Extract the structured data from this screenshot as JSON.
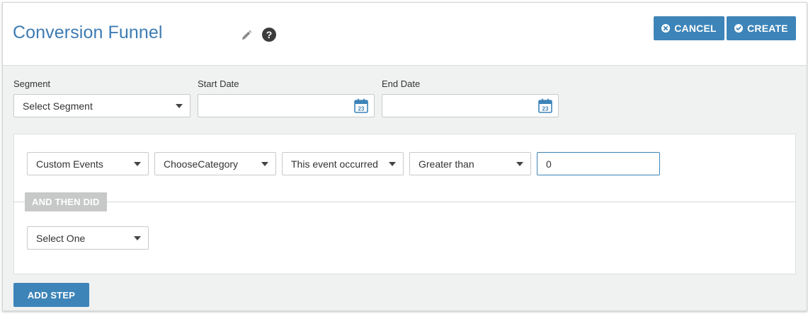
{
  "header": {
    "title": "Conversion Funnel",
    "help_symbol": "?",
    "cancel_label": "CANCEL",
    "create_label": "CREATE"
  },
  "filters": {
    "segment_label": "Segment",
    "segment_value": "Select Segment",
    "start_date_label": "Start Date",
    "start_date_value": "",
    "end_date_label": "End Date",
    "end_date_value": ""
  },
  "step": {
    "event_type": "Custom Events",
    "event_name": "ChooseCategory",
    "condition": "This event occurred",
    "comparator": "Greater than",
    "value": "0",
    "connector_label": "AND THEN DID",
    "next_select": "Select One"
  },
  "footer": {
    "add_step_label": "ADD STEP"
  },
  "colors": {
    "accent": "#3d84b8",
    "title": "#3d7cb3",
    "tag_bg": "#c7c9c8",
    "page_bg": "#f0f2f1"
  },
  "icons": [
    "pencil-icon",
    "help-icon",
    "cancel-circle-icon",
    "check-circle-icon",
    "calendar-icon",
    "caret-down-icon"
  ]
}
